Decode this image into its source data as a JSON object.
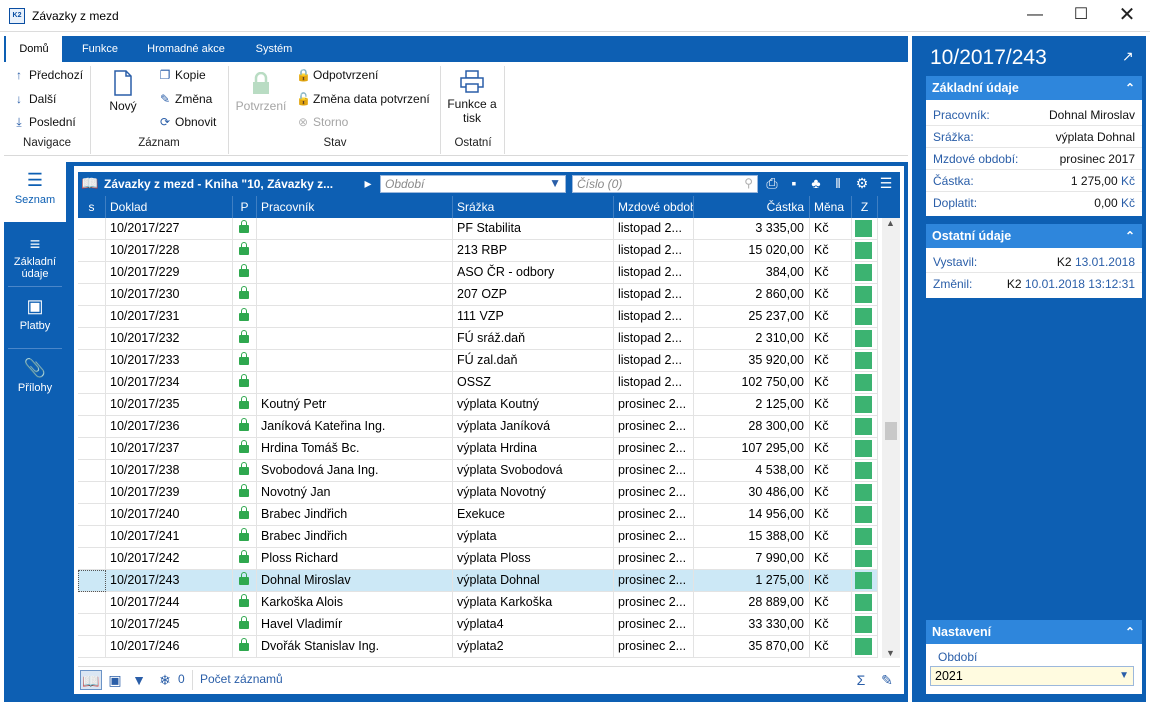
{
  "window": {
    "title": "Závazky z mezd"
  },
  "ribbon": {
    "tabs": [
      "Domů",
      "Funkce",
      "Hromadné akce",
      "Systém"
    ],
    "navigace": {
      "title": "Navigace",
      "prev": "Předchozí",
      "next": "Další",
      "last": "Poslední"
    },
    "zaznam": {
      "title": "Záznam",
      "new": "Nový",
      "copy": "Kopie",
      "edit": "Změna",
      "refresh": "Obnovit"
    },
    "stav": {
      "title": "Stav",
      "confirm": "Potvrzení",
      "unconfirm": "Odpotvrzení",
      "change_date": "Změna data potvrzení",
      "storno": "Storno"
    },
    "ostatni": {
      "title": "Ostatní",
      "print_l1": "Funkce a",
      "print_l2": "tisk"
    }
  },
  "sidenav": [
    "Seznam",
    "Základní údaje",
    "Platby",
    "Přílohy"
  ],
  "grid": {
    "title": "Závazky z mezd - Kniha \"10, Závazky z...",
    "obdobi_placeholder": "Období",
    "cislo_placeholder": "Číslo (0)",
    "columns": [
      "s",
      "Doklad",
      "P",
      "Pracovník",
      "Srážka",
      "Mzdové obdob",
      "Částka",
      "Měna",
      "Z"
    ],
    "rows": [
      {
        "doklad": "10/2017/227",
        "pracovnik": "",
        "srazka": "PF Stabilita",
        "obdobi": "listopad 2...",
        "castka": "3 335,00",
        "mena": "Kč"
      },
      {
        "doklad": "10/2017/228",
        "pracovnik": "",
        "srazka": "213 RBP",
        "obdobi": "listopad 2...",
        "castka": "15 020,00",
        "mena": "Kč"
      },
      {
        "doklad": "10/2017/229",
        "pracovnik": "",
        "srazka": "ASO ČR - odbory",
        "obdobi": "listopad 2...",
        "castka": "384,00",
        "mena": "Kč"
      },
      {
        "doklad": "10/2017/230",
        "pracovnik": "",
        "srazka": "207 OZP",
        "obdobi": "listopad 2...",
        "castka": "2 860,00",
        "mena": "Kč"
      },
      {
        "doklad": "10/2017/231",
        "pracovnik": "",
        "srazka": "111 VZP",
        "obdobi": "listopad 2...",
        "castka": "25 237,00",
        "mena": "Kč"
      },
      {
        "doklad": "10/2017/232",
        "pracovnik": "",
        "srazka": "FÚ sráž.daň",
        "obdobi": "listopad 2...",
        "castka": "2 310,00",
        "mena": "Kč"
      },
      {
        "doklad": "10/2017/233",
        "pracovnik": "",
        "srazka": "FÚ zal.daň",
        "obdobi": "listopad 2...",
        "castka": "35 920,00",
        "mena": "Kč"
      },
      {
        "doklad": "10/2017/234",
        "pracovnik": "",
        "srazka": "OSSZ",
        "obdobi": "listopad 2...",
        "castka": "102 750,00",
        "mena": "Kč"
      },
      {
        "doklad": "10/2017/235",
        "pracovnik": "Koutný Petr",
        "srazka": "výplata Koutný",
        "obdobi": "prosinec 2...",
        "castka": "2 125,00",
        "mena": "Kč"
      },
      {
        "doklad": "10/2017/236",
        "pracovnik": "Janíková Kateřina Ing.",
        "srazka": "výplata Janíková",
        "obdobi": "prosinec 2...",
        "castka": "28 300,00",
        "mena": "Kč"
      },
      {
        "doklad": "10/2017/237",
        "pracovnik": "Hrdina Tomáš Bc.",
        "srazka": "výplata Hrdina",
        "obdobi": "prosinec 2...",
        "castka": "107 295,00",
        "mena": "Kč"
      },
      {
        "doklad": "10/2017/238",
        "pracovnik": "Svobodová Jana Ing.",
        "srazka": "výplata Svobodová",
        "obdobi": "prosinec 2...",
        "castka": "4 538,00",
        "mena": "Kč"
      },
      {
        "doklad": "10/2017/239",
        "pracovnik": "Novotný Jan",
        "srazka": "výplata Novotný",
        "obdobi": "prosinec 2...",
        "castka": "30 486,00",
        "mena": "Kč"
      },
      {
        "doklad": "10/2017/240",
        "pracovnik": "Brabec Jindřich",
        "srazka": "Exekuce",
        "obdobi": "prosinec 2...",
        "castka": "14 956,00",
        "mena": "Kč"
      },
      {
        "doklad": "10/2017/241",
        "pracovnik": "Brabec Jindřich",
        "srazka": "výplata",
        "obdobi": "prosinec 2...",
        "castka": "15 388,00",
        "mena": "Kč"
      },
      {
        "doklad": "10/2017/242",
        "pracovnik": "Ploss Richard",
        "srazka": "výplata Ploss",
        "obdobi": "prosinec 2...",
        "castka": "7 990,00",
        "mena": "Kč"
      },
      {
        "doklad": "10/2017/243",
        "pracovnik": "Dohnal Miroslav",
        "srazka": "výplata Dohnal",
        "obdobi": "prosinec 2...",
        "castka": "1 275,00",
        "mena": "Kč",
        "selected": true
      },
      {
        "doklad": "10/2017/244",
        "pracovnik": "Karkoška Alois",
        "srazka": "výplata Karkoška",
        "obdobi": "prosinec 2...",
        "castka": "28 889,00",
        "mena": "Kč"
      },
      {
        "doklad": "10/2017/245",
        "pracovnik": "Havel Vladimír",
        "srazka": "výplata4",
        "obdobi": "prosinec 2...",
        "castka": "33 330,00",
        "mena": "Kč"
      },
      {
        "doklad": "10/2017/246",
        "pracovnik": "Dvořák Stanislav Ing.",
        "srazka": "výplata2",
        "obdobi": "prosinec 2...",
        "castka": "35 870,00",
        "mena": "Kč"
      }
    ],
    "footer": {
      "filter_count": "0",
      "record_count": "Počet záznamů"
    }
  },
  "detail": {
    "title": "10/2017/243",
    "zakladni": {
      "title": "Základní údaje",
      "fields": [
        {
          "k": "Pracovník:",
          "v": "Dohnal Miroslav"
        },
        {
          "k": "Srážka:",
          "v": "výplata Dohnal"
        },
        {
          "k": "Mzdové období:",
          "v": "prosinec 2017"
        },
        {
          "k": "Částka:",
          "v": "1 275,00",
          "unit": "Kč"
        },
        {
          "k": "Doplatit:",
          "v": "0,00",
          "unit": "Kč"
        }
      ]
    },
    "ostatni": {
      "title": "Ostatní údaje",
      "vystavil_label": "Vystavil:",
      "vystavil_user": "K2",
      "vystavil_date": "13.01.2018",
      "zmenil_label": "Změnil:",
      "zmenil_user": "K2",
      "zmenil_date": "10.01.2018 13:12:31"
    },
    "nastaveni": {
      "title": "Nastavení",
      "obdobi_label": "Období",
      "obdobi_value": "2021"
    }
  },
  "colors": {
    "accent": "#0d5fb3",
    "section": "#2e86dc",
    "selected_row": "#cce8f6",
    "status_green": "#3cb371"
  }
}
